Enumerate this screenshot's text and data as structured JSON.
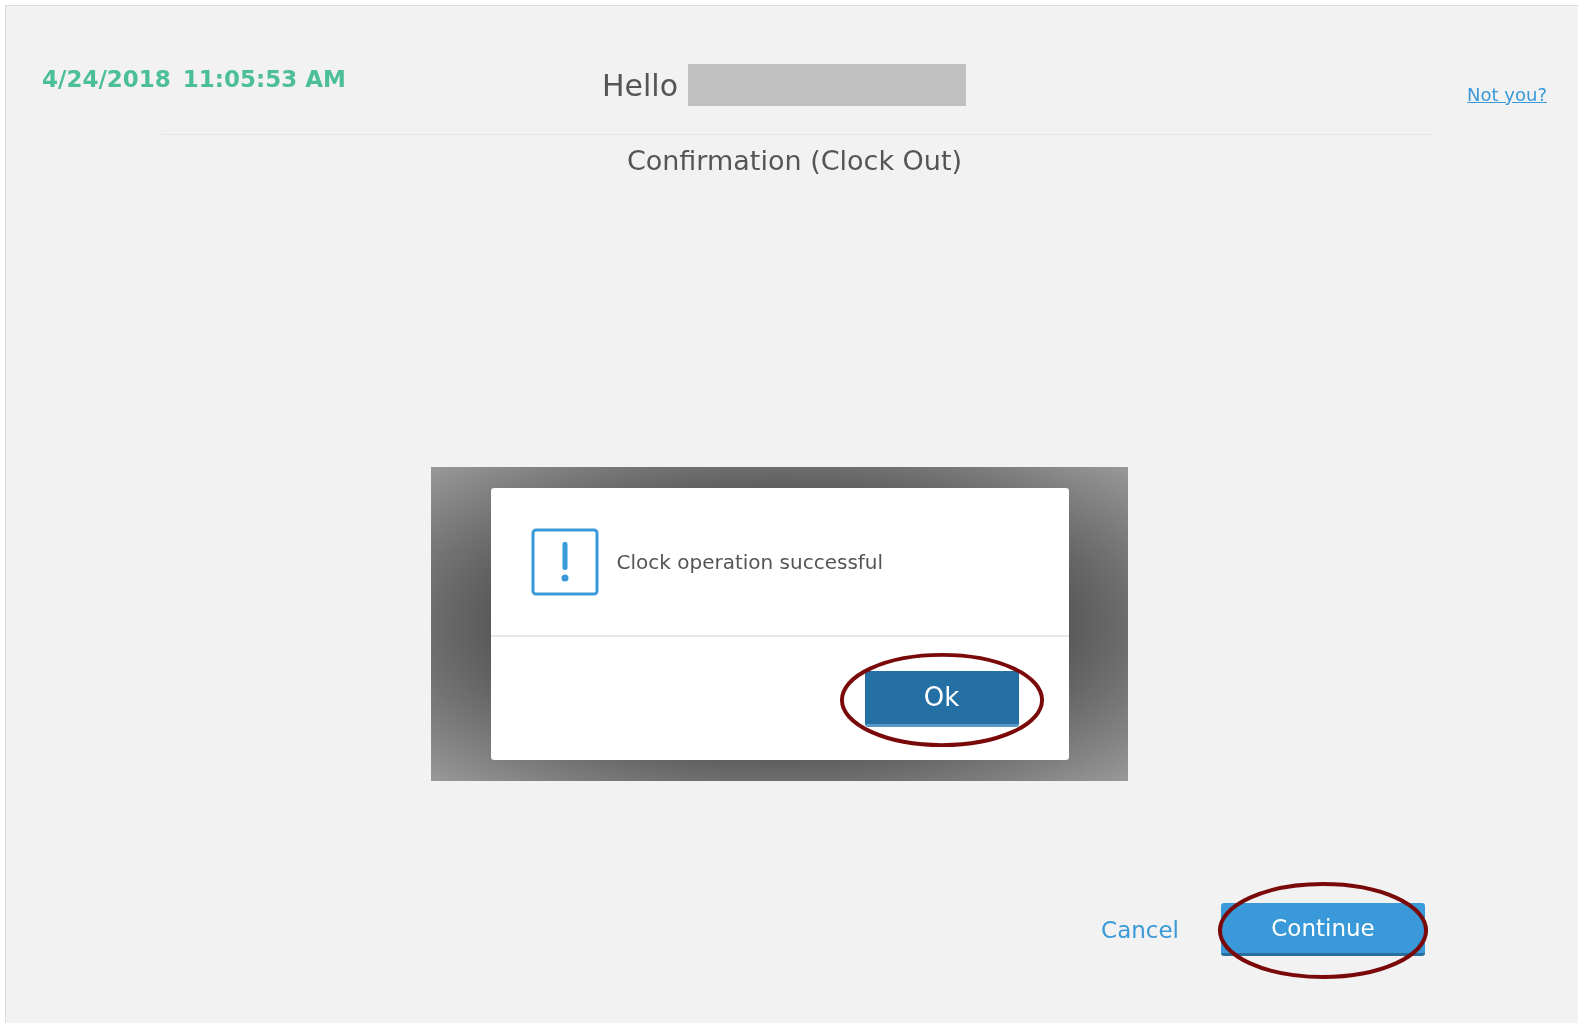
{
  "header": {
    "date": "4/24/2018",
    "time": "11:05:53 AM",
    "greeting": "Hello",
    "not_you_link": "Not you?"
  },
  "title": "Confirmation (Clock Out)",
  "dialog": {
    "message": "Clock operation successful",
    "button": "Ok",
    "button_circled": true
  },
  "actions": {
    "cancel": "Cancel",
    "continue": "Continue",
    "continue_circled": true
  }
}
